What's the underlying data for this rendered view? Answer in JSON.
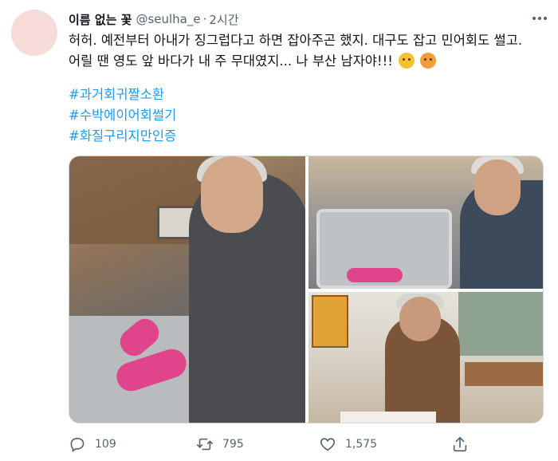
{
  "author": {
    "display_name": "이름 없는 꽃",
    "handle": "@seulha_e",
    "separator": "·",
    "timestamp": "2시간"
  },
  "tweet": {
    "text": "허허. 예전부터 아내가 징그럽다고 하면 잡아주곤 했지. 대구도 잡고 민어회도 썰고. 어릴 땐 영도 앞 바다가 내 주 무대였지... 나 부산 남자야!!!",
    "emojis": [
      "face-with-raised-eyebrow-emoji",
      "face-with-steam-emoji"
    ],
    "hashtags": [
      "#과거회귀짤소환",
      "#수박에이어회썰기",
      "#화질구리지만인증"
    ]
  },
  "media": {
    "photo_count": 3
  },
  "actions": {
    "reply_count": "109",
    "retweet_count": "795",
    "like_count": "1,575",
    "icons": [
      "reply-icon",
      "retweet-icon",
      "like-icon",
      "share-icon"
    ]
  },
  "colors": {
    "text": "#0f1419",
    "secondary": "#536471",
    "link": "#1d9bf0",
    "border": "#cfd9de",
    "avatar_bg": "#f6dcd8"
  }
}
